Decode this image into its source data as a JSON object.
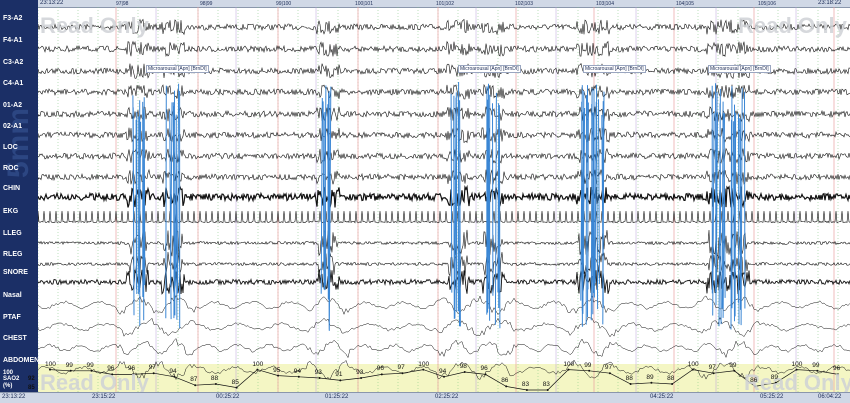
{
  "app": {
    "watermark": "Read Only"
  },
  "top_ruler": {
    "start_time": "23:13:22",
    "end_time": "23:18:22",
    "epochs": [
      "97|98",
      "98|99",
      "99|100",
      "100|101",
      "101|102",
      "102|103",
      "103|104",
      "104|105",
      "105|106"
    ]
  },
  "bottom_ruler": {
    "left_time": "23:13:22",
    "times": [
      "23:15:22",
      "00:25:22",
      "01:25:22",
      "02:25:22",
      "04:25:22",
      "05:25:22"
    ],
    "end_time": "06:04:22"
  },
  "channels": [
    "F3-A2",
    "F4-A1",
    "C3-A2",
    "C4-A1",
    "01-A2",
    "02-A1",
    "LOC",
    "ROC",
    "CHIN",
    "EKG",
    "LLEG",
    "RLEG",
    "SNORE",
    "Nasal",
    "PTAF",
    "CHEST",
    "ABDOMEN"
  ],
  "spo2": {
    "label": "SAO2",
    "unit": "(%)",
    "scale": [
      "100",
      "92",
      "85"
    ],
    "values": [
      "100",
      "99",
      "99",
      "96",
      "96",
      "97",
      "94",
      "87",
      "88",
      "85",
      "100",
      "95",
      "94",
      "93",
      "91",
      "93",
      "96",
      "97",
      "100",
      "94",
      "98",
      "96",
      "86",
      "83",
      "83",
      "100",
      "99",
      "97",
      "88",
      "89",
      "88",
      "100",
      "97",
      "99",
      "86",
      "89",
      "100",
      "99",
      "96"
    ]
  },
  "events": [
    {
      "label": "Microarousal [Apn] [BrnDI]"
    },
    {
      "label": "Microarousal [Apn] [BrnDI]"
    },
    {
      "label": "Microarousal [Apn] [BrnDI]"
    },
    {
      "label": "Microarousal [Apn] [BrnDI]"
    }
  ],
  "scale_label": "5mm",
  "colors": {
    "panel": "#1b2f66",
    "trace": "#111111",
    "snore_burst": "#3a86d4",
    "grid_red": "#e8a0a0",
    "grid_green": "#7cc47c",
    "grid_purple": "#b8a0d8",
    "spo2_fill": "#f4f6c4"
  }
}
